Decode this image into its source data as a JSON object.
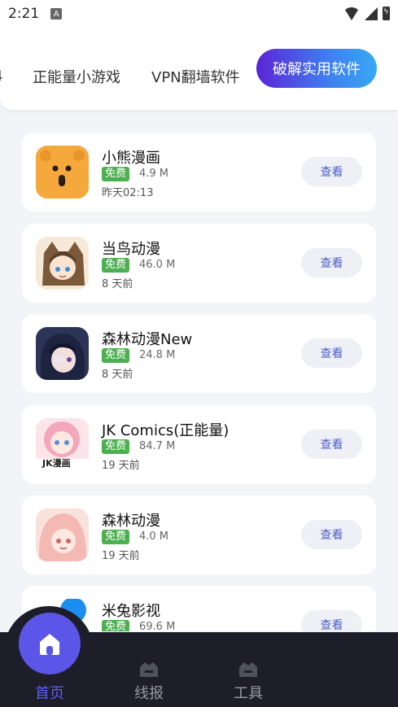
{
  "status": {
    "time": "2:21",
    "notif_badge": "A"
  },
  "tabs": {
    "cut_off": "4",
    "items": [
      "正能量小游戏",
      "VPN翻墙软件"
    ],
    "active": "破解实用软件"
  },
  "apps": [
    {
      "name": "小熊漫画",
      "badge": "免费",
      "size": "4.9 M",
      "date": "昨天02:13",
      "action": "查看",
      "icon": "bear-icon"
    },
    {
      "name": "当鸟动漫",
      "badge": "免费",
      "size": "46.0 M",
      "date": "8 天前",
      "action": "查看",
      "icon": "anime-girl-hood-icon"
    },
    {
      "name": "森林动漫New",
      "badge": "免费",
      "size": "24.8 M",
      "date": "8 天前",
      "action": "查看",
      "icon": "anime-boy-dark-icon"
    },
    {
      "name": "JK Comics(正能量)",
      "badge": "免费",
      "size": "84.7 M",
      "date": "19 天前",
      "action": "查看",
      "icon": "jk-anime-girl-icon",
      "icon_text": "JK漫画"
    },
    {
      "name": "森林动漫",
      "badge": "免费",
      "size": "4.0 M",
      "date": "19 天前",
      "action": "查看",
      "icon": "anime-girl-pink-icon"
    },
    {
      "name": "米兔影视",
      "badge": "免费",
      "size": "69.6 M",
      "date": "",
      "action": "查看",
      "icon": "mitu-icon"
    }
  ],
  "nav": {
    "home": "首页",
    "news": "线报",
    "tools": "工具"
  },
  "colors": {
    "accent": "#5b56e8",
    "free_badge": "#4caf50",
    "nav_bg": "#1d1e2a"
  }
}
